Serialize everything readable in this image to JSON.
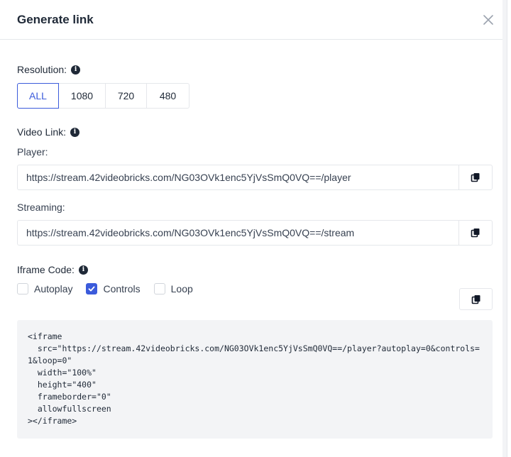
{
  "modal": {
    "title": "Generate link",
    "close_icon": "close-icon"
  },
  "resolution": {
    "label": "Resolution:",
    "options": [
      "ALL",
      "1080",
      "720",
      "480"
    ],
    "selected": "ALL"
  },
  "video_link": {
    "label": "Video Link:",
    "player_label": "Player:",
    "player_url": "https://stream.42videobricks.com/NG03OVk1enc5YjVsSmQ0VQ==/player",
    "streaming_label": "Streaming:",
    "streaming_url": "https://stream.42videobricks.com/NG03OVk1enc5YjVsSmQ0VQ==/stream"
  },
  "iframe": {
    "label": "Iframe Code:",
    "autoplay_label": "Autoplay",
    "autoplay_checked": false,
    "controls_label": "Controls",
    "controls_checked": true,
    "loop_label": "Loop",
    "loop_checked": false,
    "code": "<iframe\n  src=\"https://stream.42videobricks.com/NG03OVk1enc5YjVsSmQ0VQ==/player?autoplay=0&controls=1&loop=0\"\n  width=\"100%\"\n  height=\"400\"\n  frameborder=\"0\"\n  allowfullscreen\n></iframe>"
  },
  "colors": {
    "accent": "#3b5bdb",
    "code_bg": "#f3f4f6",
    "border": "#e5e7eb"
  }
}
